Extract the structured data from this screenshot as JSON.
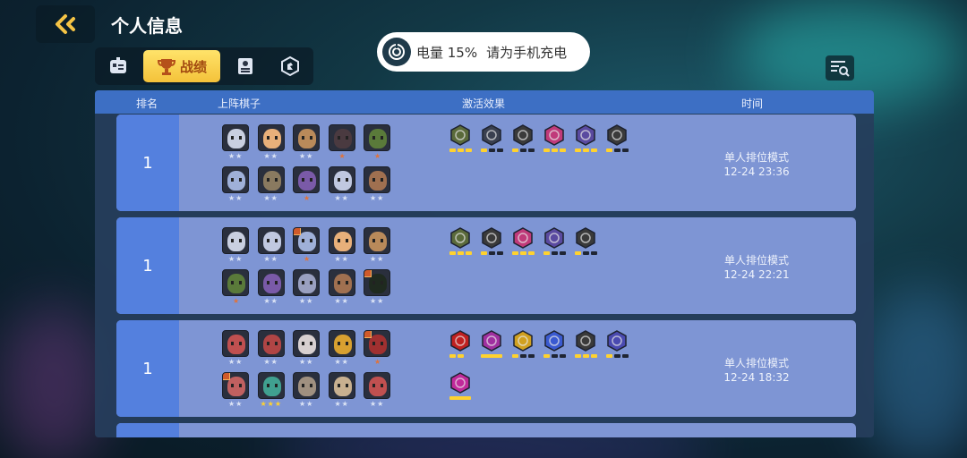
{
  "header": {
    "title": "个人信息"
  },
  "tabs": [
    {
      "icon": "robot-icon"
    },
    {
      "icon": "trophy-icon",
      "label": "战绩"
    },
    {
      "icon": "certificate-icon"
    },
    {
      "icon": "hexagon-emblem-icon"
    }
  ],
  "battery": {
    "text": "电量 15%",
    "hint": "请为手机充电"
  },
  "table": {
    "columns": [
      "排名",
      "上阵棋子",
      "激活效果",
      "时间"
    ],
    "rows": [
      {
        "rank": "1",
        "mode": "单人排位模式",
        "time": "12-24 23:36"
      },
      {
        "rank": "1",
        "mode": "单人排位模式",
        "time": "12-24 22:21"
      },
      {
        "rank": "1",
        "mode": "单人排位模式",
        "time": "12-24 18:32"
      }
    ]
  },
  "colors": {
    "accent": "#3d6fc4",
    "row_bg": "#7e95d4",
    "rank_bg": "#5480de",
    "tab_active": "#f4c23a",
    "star_gold": "#ffd22f"
  }
}
